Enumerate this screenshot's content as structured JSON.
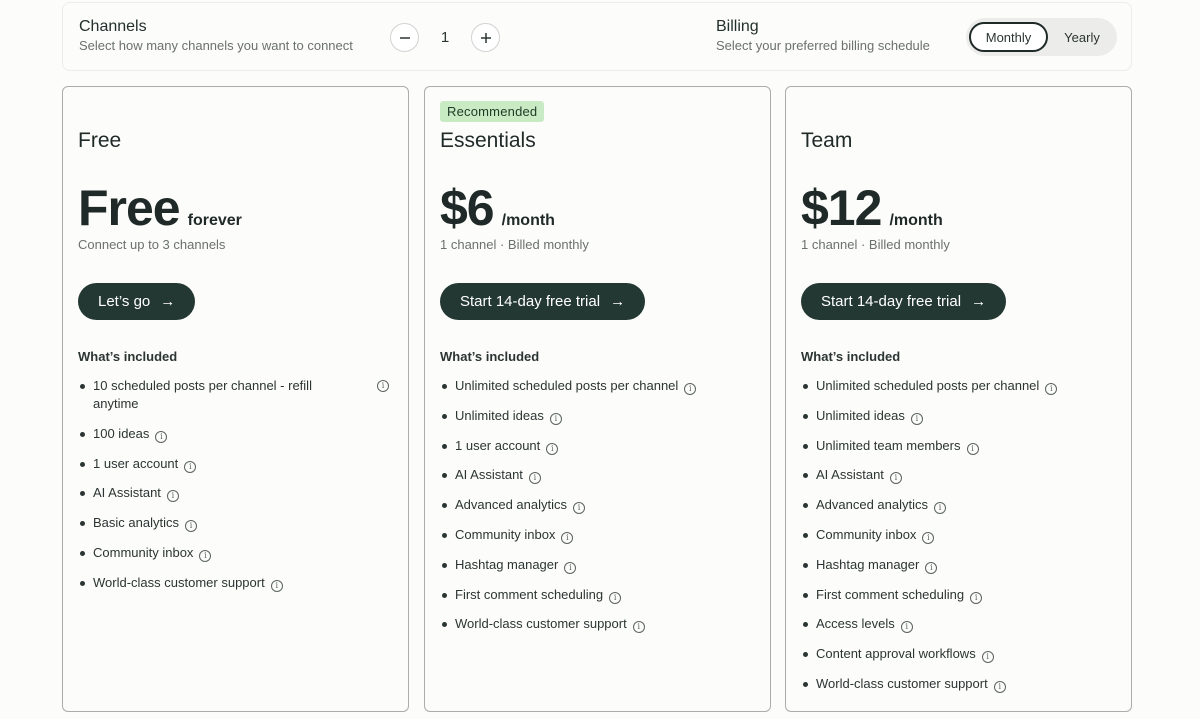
{
  "channels": {
    "title": "Channels",
    "subtitle": "Select how many channels you want to connect",
    "value": "1",
    "minus_icon": "minus",
    "plus_icon": "+"
  },
  "billing": {
    "title": "Billing",
    "subtitle": "Select your preferred billing schedule",
    "options": [
      "Monthly",
      "Yearly"
    ],
    "selected": "Monthly"
  },
  "plans": [
    {
      "badge": "",
      "name": "Free",
      "price": "Free",
      "suffix": "forever",
      "note": "Connect up to 3 channels",
      "cta": "Let’s go",
      "included_label": "What’s included",
      "features": [
        "10 scheduled posts per channel - refill anytime",
        "100 ideas",
        "1 user account",
        "AI Assistant",
        "Basic analytics",
        "Community inbox",
        "World-class customer support"
      ]
    },
    {
      "badge": "Recommended",
      "name": "Essentials",
      "price": "$6",
      "suffix": "/month",
      "note": "1 channel · Billed monthly",
      "cta": "Start 14-day free trial",
      "included_label": "What’s included",
      "features": [
        "Unlimited scheduled posts per channel",
        "Unlimited ideas",
        "1 user account",
        "AI Assistant",
        "Advanced analytics",
        "Community inbox",
        "Hashtag manager",
        "First comment scheduling",
        "World-class customer support"
      ]
    },
    {
      "badge": "",
      "name": "Team",
      "price": "$12",
      "suffix": "/month",
      "note": "1 channel · Billed monthly",
      "cta": "Start 14-day free trial",
      "included_label": "What’s included",
      "features": [
        "Unlimited scheduled posts per channel",
        "Unlimited ideas",
        "Unlimited team members",
        "AI Assistant",
        "Advanced analytics",
        "Community inbox",
        "Hashtag manager",
        "First comment scheduling",
        "Access levels",
        "Content approval workflows",
        "World-class customer support"
      ]
    }
  ],
  "icons": {
    "info": "info-icon",
    "cta_arrow": "arrow-right-icon"
  },
  "colors": {
    "cta_bg": "#233832",
    "badge_bg": "#c8ebc4",
    "text": "#1f2a28"
  }
}
